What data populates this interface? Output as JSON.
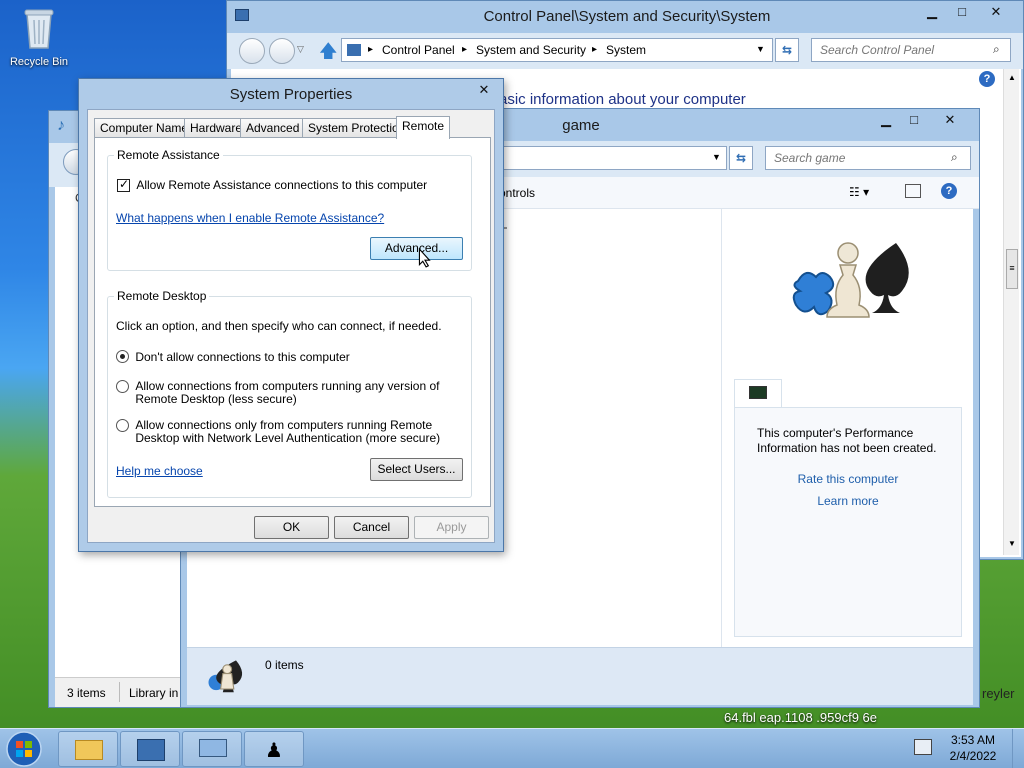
{
  "desktop": {
    "recycle_bin_label": "Recycle Bin"
  },
  "control_panel": {
    "title": "Control Panel\\System and Security\\System",
    "breadcrumb": [
      "Control Panel",
      "System and Security",
      "System"
    ],
    "search_placeholder": "Search Control Panel",
    "heading_partial": "asic information about your computer"
  },
  "game_window": {
    "title": "game",
    "search_placeholder": "Search game",
    "controls_partial": "ontrols",
    "perf_text": "This computer's Performance Information has not been created.",
    "rate_link": "Rate this computer",
    "learn_link": "Learn more",
    "status_items": "0 items"
  },
  "library_window": {
    "status_items": "3 items",
    "status_library": "Library in"
  },
  "background_text": {
    "right_edge": "reyler",
    "hash_text": "64.fbl  eap.1108  .959cf9  6e"
  },
  "dialog": {
    "title": "System Properties",
    "tabs": [
      "Computer Name",
      "Hardware",
      "Advanced",
      "System Protection",
      "Remote"
    ],
    "remote_assistance": {
      "group_label": "Remote Assistance",
      "checkbox_label": "Allow Remote Assistance connections to this computer",
      "link": "What happens when I enable Remote Assistance?",
      "advanced_button": "Advanced..."
    },
    "remote_desktop": {
      "group_label": "Remote Desktop",
      "instruction": "Click an option, and then specify who can connect, if needed.",
      "option_1": "Don't allow connections to this computer",
      "option_2_line1": "Allow connections from computers running any version of",
      "option_2_line2": "Remote Desktop (less secure)",
      "option_3_line1": "Allow connections only from computers running Remote",
      "option_3_line2": "Desktop with Network Level Authentication (more secure)",
      "help_link": "Help me choose",
      "select_users_button": "Select Users..."
    },
    "ok_button": "OK",
    "cancel_button": "Cancel",
    "apply_button": "Apply"
  },
  "taskbar": {
    "time": "3:53 AM",
    "date": "2/4/2022"
  }
}
